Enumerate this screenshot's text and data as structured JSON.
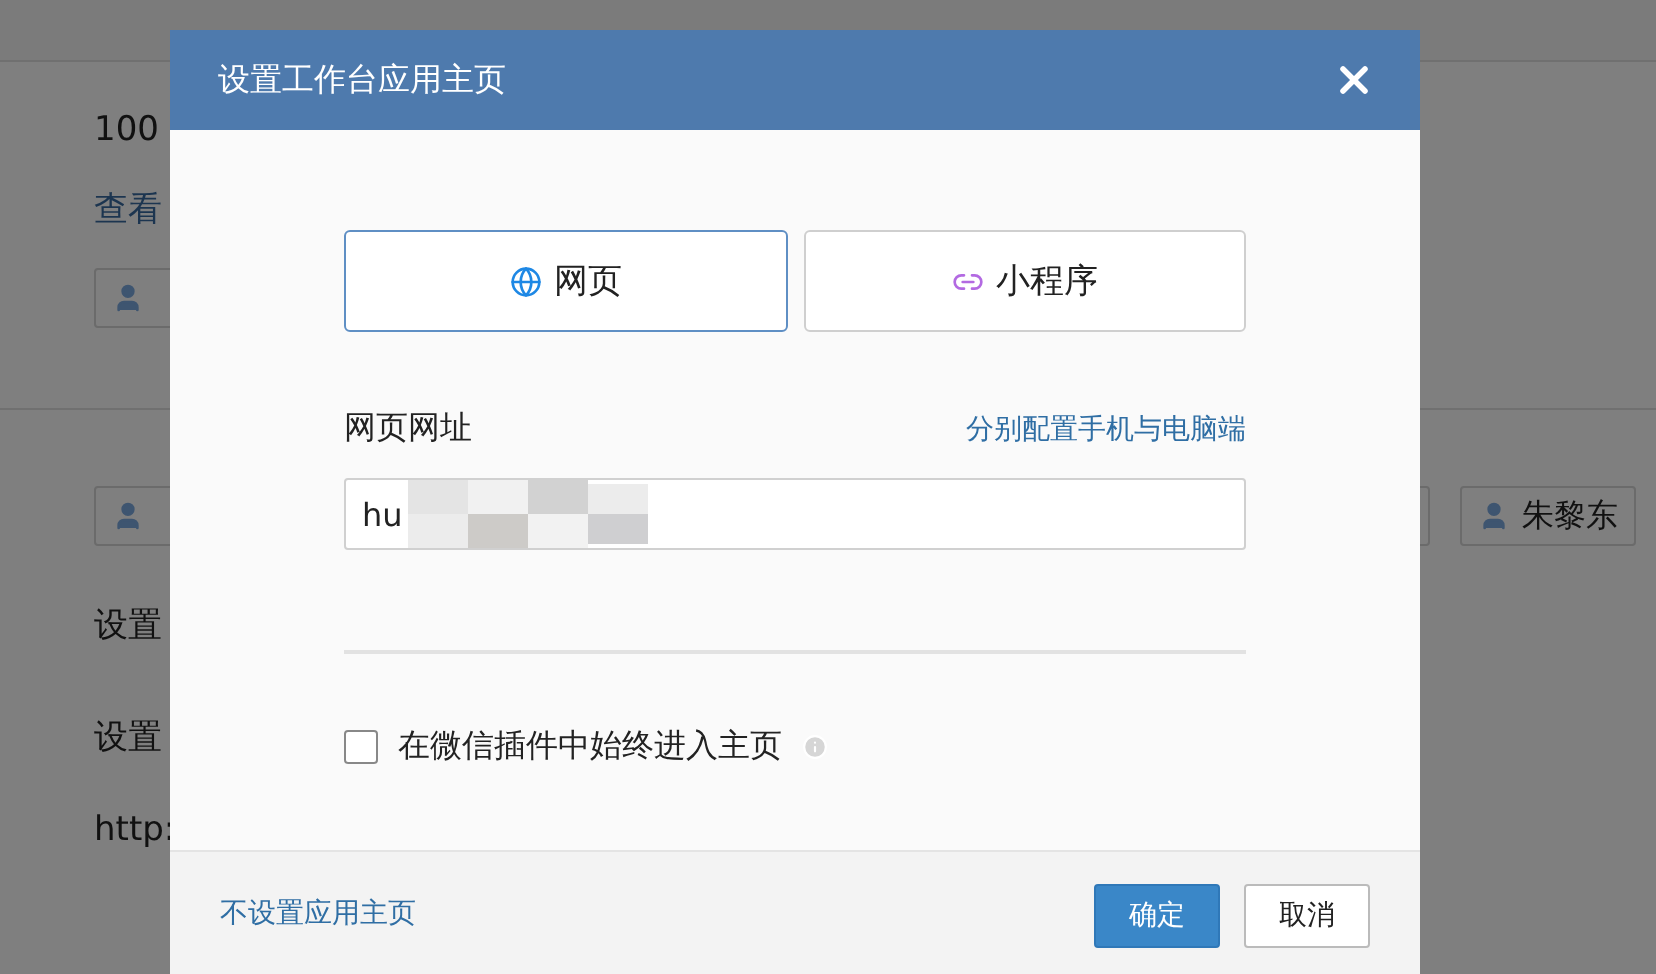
{
  "background": {
    "amount": "100",
    "view_link": "查看",
    "row_1_tags": [
      {
        "kind": "cut"
      }
    ],
    "row_2_tags": [
      {
        "kind": "cut"
      },
      {
        "kind": "edge"
      },
      {
        "kind": "full",
        "name": "朱黎东"
      }
    ],
    "settings": [
      "设置",
      "设置"
    ],
    "url": "http:"
  },
  "modal": {
    "title": "设置工作台应用主页",
    "tabs": [
      {
        "kind": "web",
        "label": "网页",
        "selected": true
      },
      {
        "kind": "mini",
        "label": "小程序",
        "selected": false
      }
    ],
    "url_field": {
      "label": "网页网址",
      "link": "分别配置手机与电脑端",
      "value": "hu"
    },
    "checkbox": {
      "label": "在微信插件中始终进入主页",
      "checked": false
    },
    "footer": {
      "link": "不设置应用主页",
      "buttons": [
        {
          "kind": "primary",
          "label": "确定"
        },
        {
          "kind": "default",
          "label": "取消"
        }
      ]
    }
  }
}
